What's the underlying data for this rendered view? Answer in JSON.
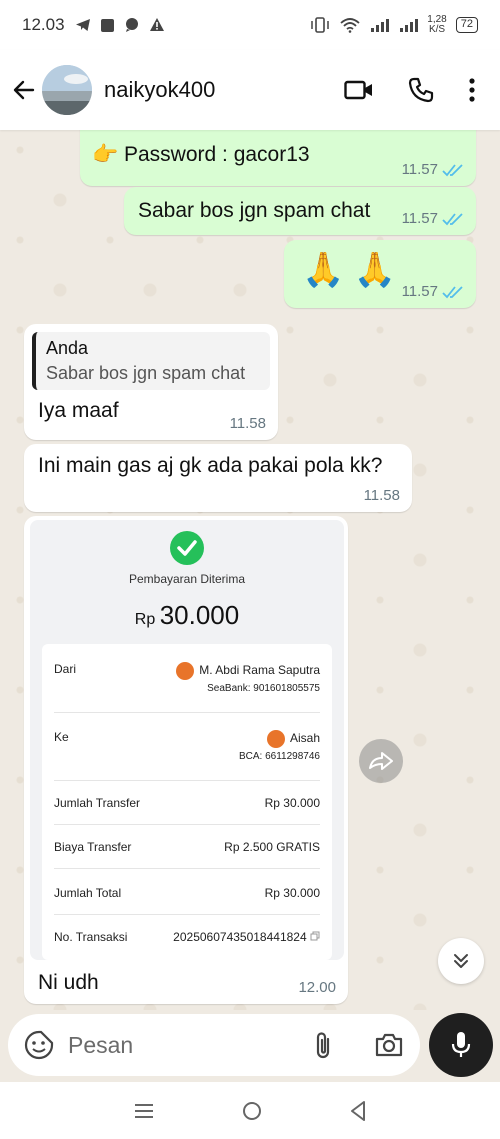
{
  "status_bar": {
    "time": "12.03",
    "net_speed_value": "1,28",
    "net_speed_unit": "K/S",
    "battery": "72"
  },
  "header": {
    "contact_name": "naikyok400"
  },
  "messages": {
    "password_line": "👉 Password : gacor13",
    "password_time": "11.57",
    "sabar_text": "Sabar bos jgn spam chat",
    "sabar_time": "11.57",
    "pray_emoji": "🙏 🙏",
    "pray_time": "11.57",
    "reply_quote_author": "Anda",
    "reply_quote_text": "Sabar bos jgn spam chat",
    "reply_text": "Iya maaf",
    "reply_time": "11.58",
    "question_text": "Ini main gas aj gk ada pakai pola kk?",
    "question_time": "11.58",
    "receipt_caption": "Ni udh",
    "receipt_time": "12.00"
  },
  "receipt": {
    "status": "Pembayaran Diterima",
    "currency": "Rp",
    "amount": "30.000",
    "from_label": "Dari",
    "from_name": "M. Abdi Rama Saputra",
    "from_bank": "SeaBank: 901601805575",
    "to_label": "Ke",
    "to_name": "Aisah",
    "to_bank": "BCA: 6611298746",
    "jumlah_transfer_label": "Jumlah Transfer",
    "jumlah_transfer_value": "Rp 30.000",
    "biaya_label": "Biaya Transfer",
    "biaya_value": "Rp 2.500 GRATIS",
    "total_label": "Jumlah Total",
    "total_value": "Rp 30.000",
    "transaksi_label": "No. Transaksi",
    "transaksi_value": "20250607435018441824"
  },
  "input": {
    "placeholder": "Pesan"
  },
  "colors": {
    "outgoing_bubble": "#d9fdd3",
    "incoming_bubble": "#ffffff",
    "read_tick": "#53bdeb",
    "success_green": "#25c05a",
    "wallpaper": "#efeae2"
  }
}
